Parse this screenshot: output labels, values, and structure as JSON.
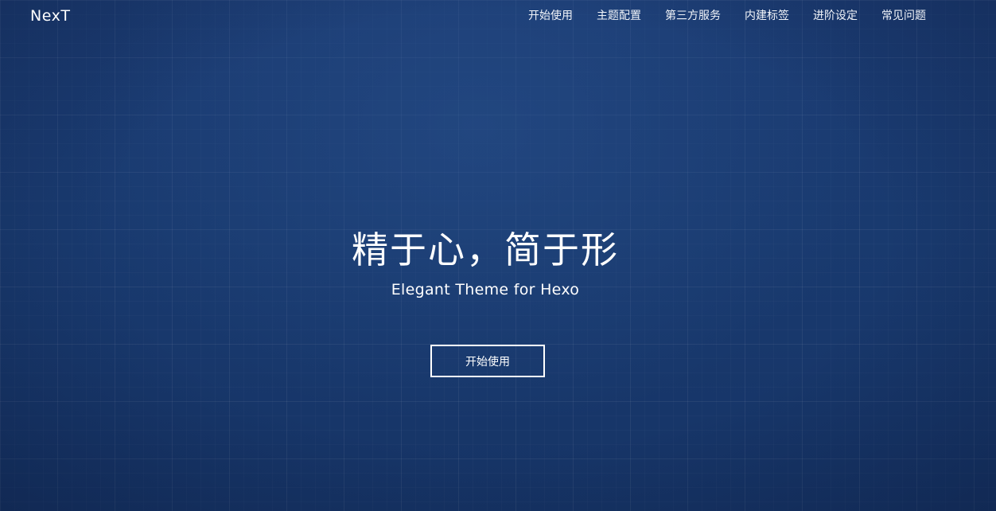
{
  "header": {
    "logo": "NexT",
    "nav": [
      {
        "label": "开始使用"
      },
      {
        "label": "主题配置"
      },
      {
        "label": "第三方服务"
      },
      {
        "label": "内建标签"
      },
      {
        "label": "进阶设定"
      },
      {
        "label": "常见问题"
      }
    ]
  },
  "hero": {
    "title": "精于心，简于形",
    "subtitle": "Elegant Theme for Hexo",
    "cta_label": "开始使用"
  },
  "colors": {
    "background": "#1a3a6e",
    "text": "#ffffff"
  }
}
